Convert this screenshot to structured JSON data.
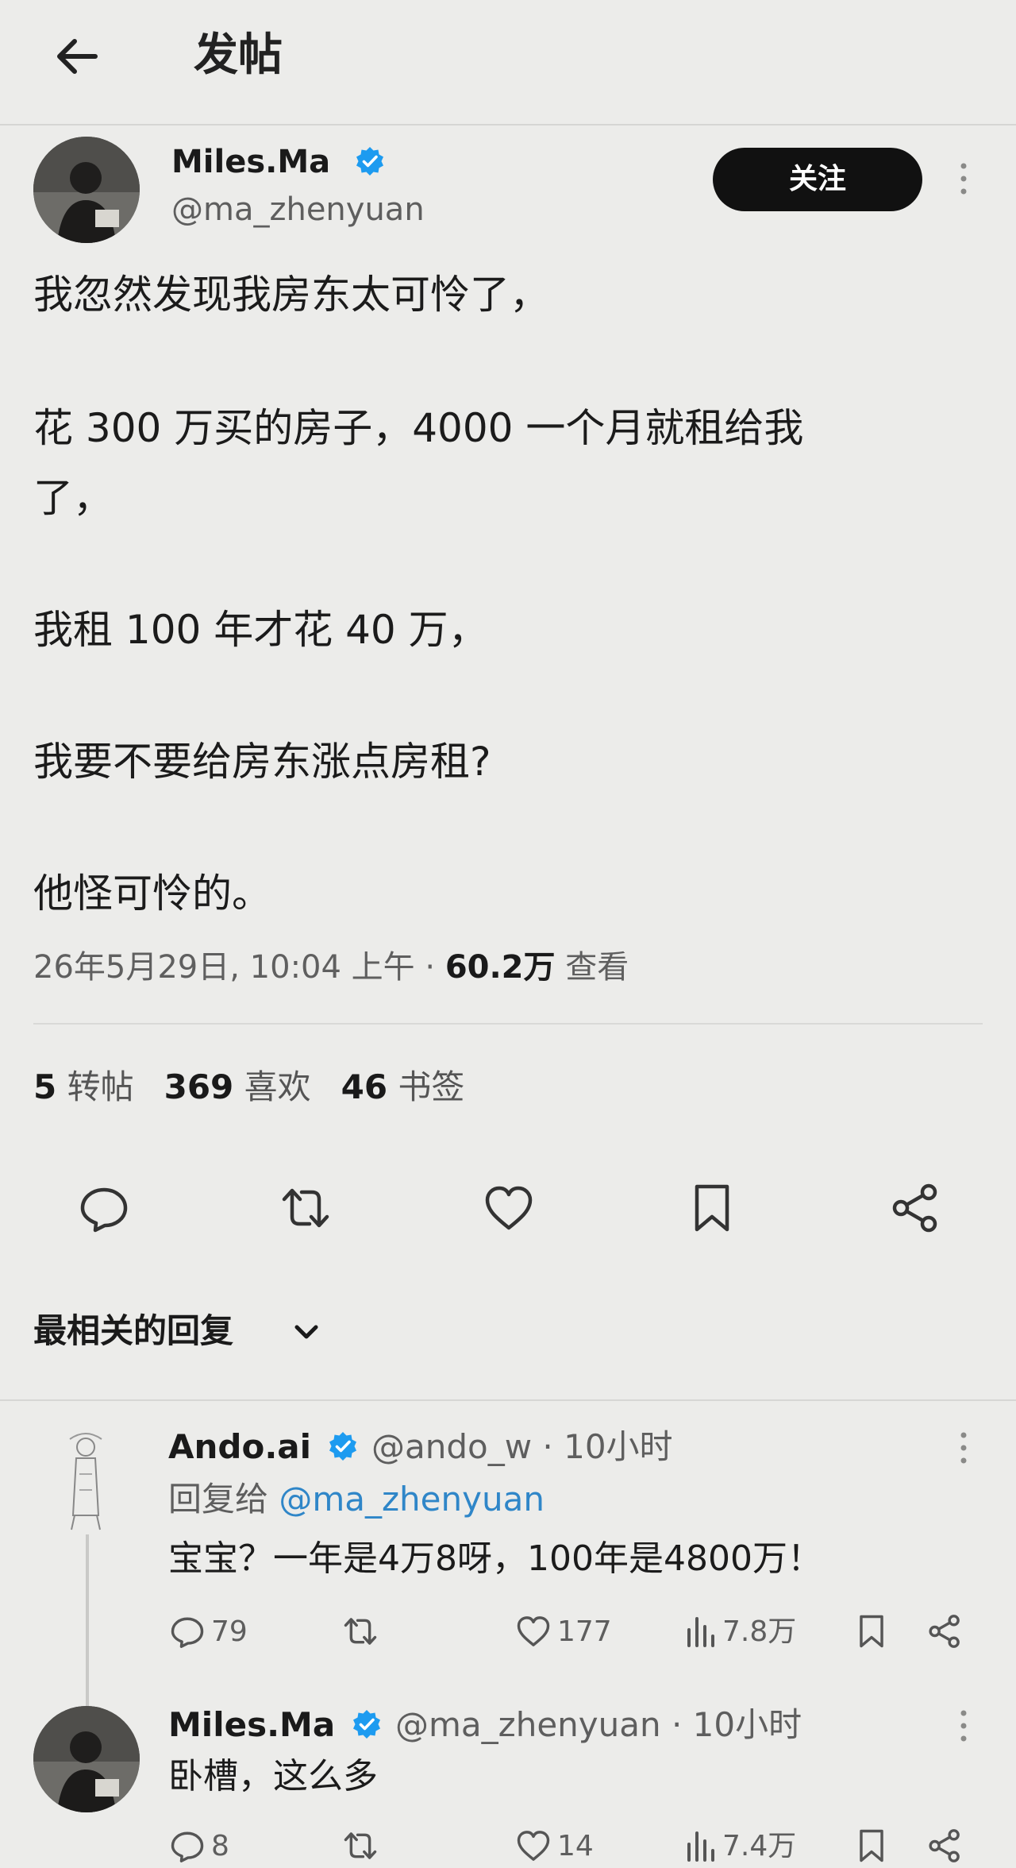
{
  "header": {
    "title": "发帖",
    "back_icon": "arrow-left-icon"
  },
  "post": {
    "author_name": "Miles.Ma",
    "author_handle": "@ma_zhenyuan",
    "follow_label": "关注",
    "lines": [
      "我忽然发现我房东太可怜了，",
      "花 300 万买的房子，4000 一个月就租给我",
      "了，",
      "我租 100 年才花 40 万，",
      "我要不要给房东涨点房租?",
      "他怪可怜的。"
    ],
    "timestamp": "26年5月29日, 10:04 上午 · ",
    "views_count": "60.2万",
    "views_label": " 查看",
    "stats": {
      "retweets_count": "5",
      "retweets_label": " 转帖",
      "likes_count": "369",
      "likes_label": " 喜欢",
      "bookmarks_count": "46",
      "bookmarks_label": " 书签"
    }
  },
  "sort": {
    "label": "最相关的回复"
  },
  "replies": [
    {
      "author_name": "Ando.ai",
      "meta": "@ando_w · 10小时",
      "reply_to_prefix": "回复给 ",
      "reply_to_handle": "@ma_zhenyuan",
      "text": "宝宝？一年是4万8呀，100年是4800万！",
      "reply_count": "79",
      "like_count": "177",
      "view_count": "7.8万"
    },
    {
      "author_name": "Miles.Ma",
      "meta": "@ma_zhenyuan · 10小时",
      "text": "卧槽，这么多",
      "reply_count": "8",
      "like_count": "14",
      "view_count": "7.4万"
    }
  ],
  "colors": {
    "background": "#ececea",
    "verified_badge": "#1d9bf0",
    "mention": "#2f86c8",
    "follow_button": "#111111"
  }
}
